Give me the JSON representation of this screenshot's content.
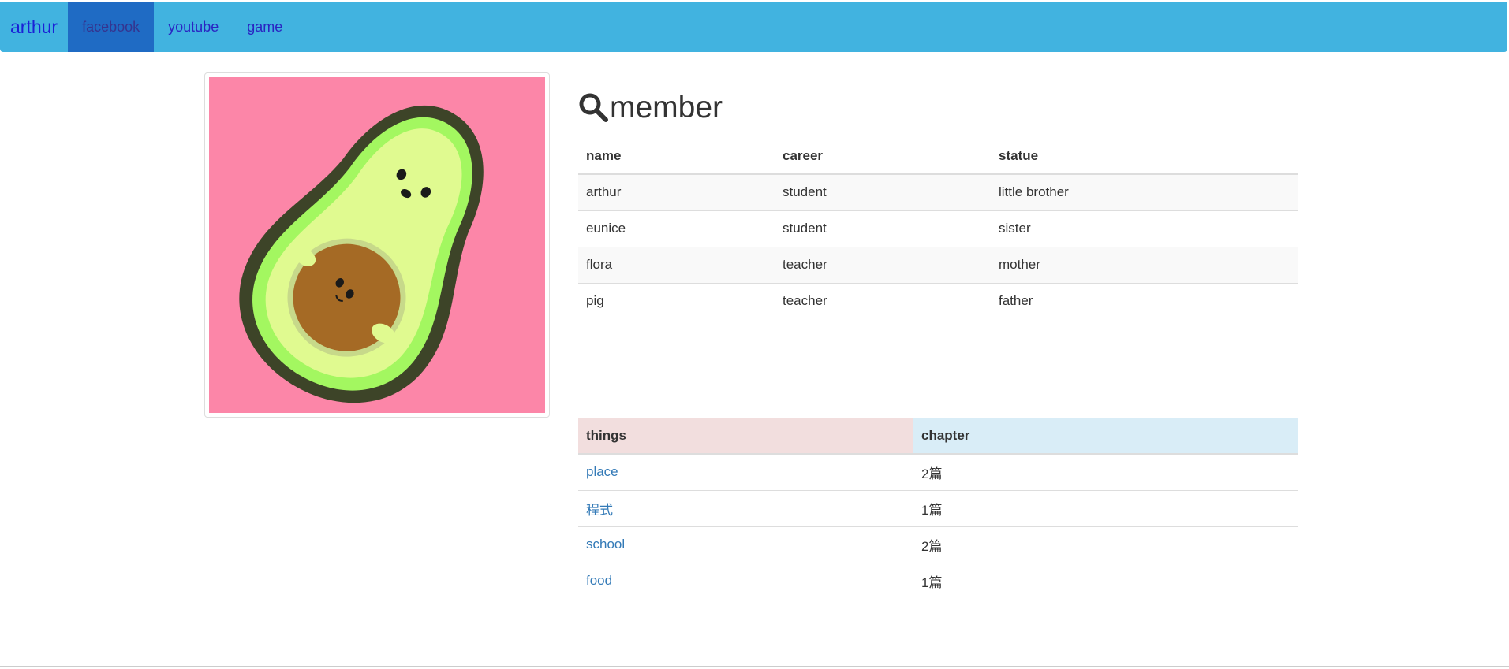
{
  "navbar": {
    "brand": "arthur",
    "items": [
      {
        "label": "facebook",
        "active": true
      },
      {
        "label": "youtube",
        "active": false
      },
      {
        "label": "game",
        "active": false
      }
    ]
  },
  "heading": {
    "title": "member",
    "icon": "search-icon"
  },
  "member_table": {
    "headers": [
      "name",
      "career",
      "statue"
    ],
    "rows": [
      [
        "arthur",
        "student",
        "little brother"
      ],
      [
        "eunice",
        "student",
        "sister"
      ],
      [
        "flora",
        "teacher",
        "mother"
      ],
      [
        "pig",
        "teacher",
        "father"
      ]
    ]
  },
  "things_table": {
    "headers": [
      "things",
      "chapter"
    ],
    "rows": [
      [
        "place",
        "2篇"
      ],
      [
        "程式",
        "1篇"
      ],
      [
        "school",
        "2篇"
      ],
      [
        "food",
        "1篇"
      ]
    ]
  },
  "colors": {
    "navbar": "#41b3e0",
    "nav_active": "#1f6bc4",
    "image_bg": "#fc86a8",
    "avocado_skin": "#3d4428",
    "avocado_flesh": "#e0fa90",
    "avocado_pit": "#a56a25"
  }
}
